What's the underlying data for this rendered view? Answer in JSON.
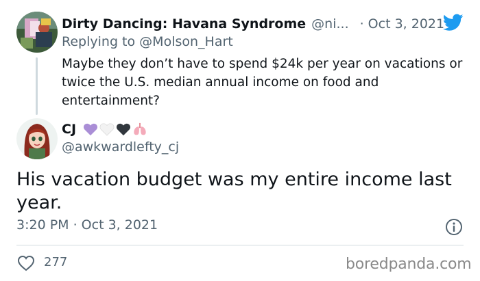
{
  "reply_tweet": {
    "display_name": "Dirty Dancing: Havana Syndrome",
    "handle": "@ni...",
    "separator": "·",
    "date": "Oct 3, 2021",
    "replying_prefix": "Replying to",
    "replying_to": "@Molson_Hart",
    "text": "Maybe they don’t have to spend $24k per year on vacations or twice the U.S. median annual income on food and entertainment?"
  },
  "main_tweet": {
    "display_name": "CJ",
    "handle": "@awkwardlefty_cj",
    "name_emojis": [
      "purple-heart",
      "white-heart",
      "black-heart",
      "lungs"
    ],
    "text": "His vacation budget was my entire income last year.",
    "timestamp": "3:20 PM · Oct 3, 2021",
    "likes": "277"
  },
  "icons": {
    "brand": "twitter-bird-icon",
    "info": "info-icon",
    "like": "heart-outline-icon"
  },
  "colors": {
    "twitter_blue": "#1d9bf0",
    "text_primary": "#0f1419",
    "text_secondary": "#536471",
    "divider": "#cfd9de",
    "purple_heart": "#aa8ed6",
    "black_heart": "#31373d",
    "lungs": "#f4abba"
  },
  "watermark": "boredpanda.com"
}
